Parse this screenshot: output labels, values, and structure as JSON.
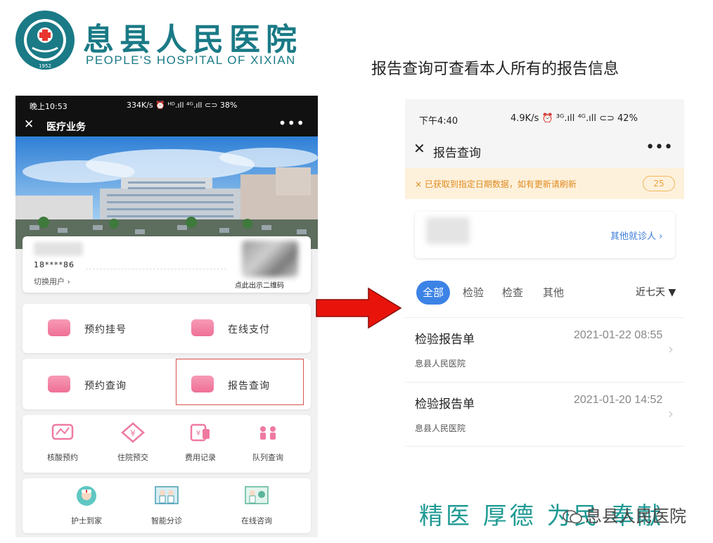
{
  "header": {
    "brand_cn": "息县人民医院",
    "brand_en": "PEOPLE'S HOSPITAL OF XIXIAN",
    "seal_year": "1952"
  },
  "caption": "报告查询可查看本人所有的报告信息",
  "left_phone": {
    "status": {
      "time": "晚上10:53",
      "indicators": "334K/s ⏰ ᴴᴰ.ıll ⁴ᴳ.ıll ⊂⊃ 38%"
    },
    "nav": {
      "title": "医疗业务",
      "close": "✕",
      "more": "•••"
    },
    "user": {
      "phone": "18****86",
      "switch_label": "切换用户 ›",
      "qr_label": "点此出示二维码"
    },
    "big_items": [
      {
        "label": "预约挂号"
      },
      {
        "label": "在线支付"
      },
      {
        "label": "预约查询"
      },
      {
        "label": "报告查询"
      }
    ],
    "small_items_row1": [
      {
        "label": "核酸预约"
      },
      {
        "label": "住院预交"
      },
      {
        "label": "费用记录"
      },
      {
        "label": "队列查询"
      }
    ],
    "small_items_row2": [
      {
        "label": "护士到家"
      },
      {
        "label": "智能分诊"
      },
      {
        "label": "在线咨询"
      }
    ]
  },
  "right_phone": {
    "status": {
      "time": "下午4:40",
      "indicators": "4.9K/s ⏰ ³ᴳ.ıll ⁴ᴳ.ıll ⊂⊃ 42%"
    },
    "nav": {
      "title": "报告查询",
      "close": "✕",
      "more": "•••"
    },
    "notice": {
      "message": "× 已获取到指定日期数据，如有更新请刷新",
      "count": "25"
    },
    "other_patient": "其他就诊人 ›",
    "tabs": [
      {
        "label": "全部",
        "active": true
      },
      {
        "label": "检验",
        "active": false
      },
      {
        "label": "检查",
        "active": false
      },
      {
        "label": "其他",
        "active": false
      }
    ],
    "range": "近七天 ▼",
    "reports": [
      {
        "title": "检验报告单",
        "date": "2021-01-22 08:55",
        "hospital": "息县人民医院"
      },
      {
        "title": "检验报告单",
        "date": "2021-01-20 14:52",
        "hospital": "息县人民医院"
      }
    ]
  },
  "slogan": "精医 厚德 为民 奉献",
  "watermark": "息县人民医院",
  "colors": {
    "brand_teal": "#1a7a86",
    "accent_blue": "#3c83e6",
    "notice_orange": "#e08a1e",
    "arrow_red": "#e8140c",
    "highlight_red": "#d9534f"
  }
}
